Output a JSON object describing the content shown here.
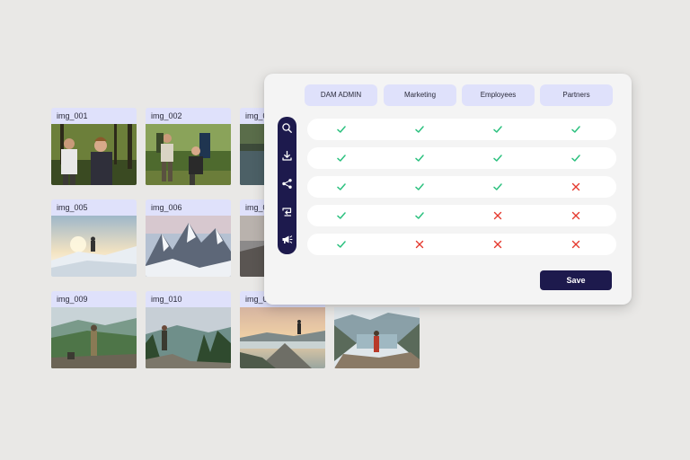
{
  "assets": [
    {
      "label": "img_001",
      "scene": "hikers-forest"
    },
    {
      "label": "img_002",
      "scene": "hikers-trail"
    },
    {
      "label": "img_0",
      "scene": "lake"
    },
    {
      "label": "img_005",
      "scene": "snow-sunrise"
    },
    {
      "label": "img_006",
      "scene": "snow-peaks"
    },
    {
      "label": "img_0",
      "scene": "mountain-dark"
    },
    {
      "label": "img_009",
      "scene": "valley-hiker"
    },
    {
      "label": "img_010",
      "scene": "ridge-hiker"
    },
    {
      "label": "img_0",
      "scene": "sunset-lake"
    },
    {
      "label": "",
      "scene": "fjord-hiker"
    }
  ],
  "permissions": {
    "roles": [
      "DAM ADMIN",
      "Marketing",
      "Employees",
      "Partners"
    ],
    "actions": [
      {
        "icon": "search-icon",
        "values": [
          true,
          true,
          true,
          true
        ]
      },
      {
        "icon": "download-icon",
        "values": [
          true,
          true,
          true,
          true
        ]
      },
      {
        "icon": "share-icon",
        "values": [
          true,
          true,
          true,
          false
        ]
      },
      {
        "icon": "repeat-icon",
        "values": [
          true,
          true,
          false,
          false
        ]
      },
      {
        "icon": "megaphone-icon",
        "values": [
          true,
          false,
          false,
          false
        ]
      }
    ],
    "save_label": "Save"
  },
  "colors": {
    "accent": "#1d1a4d",
    "allowed": "#2cc17f",
    "denied": "#e53a2f",
    "chip": "#dfe1fb"
  }
}
